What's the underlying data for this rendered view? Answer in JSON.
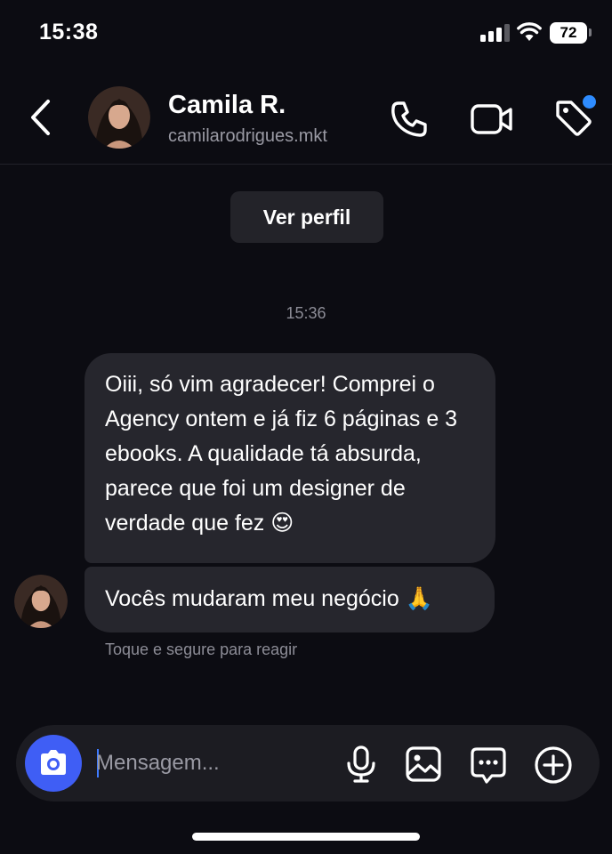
{
  "status_bar": {
    "time": "15:38",
    "battery": "72",
    "signal_icon": "cellular-signal-icon",
    "wifi_icon": "wifi-icon"
  },
  "header": {
    "contact_name": "Camila R.",
    "contact_handle": "camilarodrigues.mkt",
    "icons": [
      "chevron-left-icon",
      "phone-icon",
      "video-camera-icon",
      "tag-icon"
    ],
    "has_notification_dot": true
  },
  "conversation": {
    "view_profile_label": "Ver perfil",
    "timestamp": "15:36",
    "messages": [
      {
        "text": "Oiii, só vim agradecer! Comprei o Agency ontem e já fiz 6 páginas e 3 ebooks. A qualidade tá absurda, parece que foi um designer de verdade que fez 😍"
      },
      {
        "text": "Vocês mudaram meu negócio 🙏"
      }
    ],
    "reaction_hint": "Toque e segure para reagir"
  },
  "composer": {
    "placeholder": "Mensagem...",
    "icons": [
      "camera-icon",
      "microphone-icon",
      "image-icon",
      "chat-bubble-icon",
      "plus-circle-icon"
    ]
  },
  "colors": {
    "background": "#0c0c12",
    "bubble": "#26262d",
    "accent_blue": "#3f5ef5",
    "notification_blue": "#2e8cff",
    "muted_text": "#8c8c96"
  }
}
